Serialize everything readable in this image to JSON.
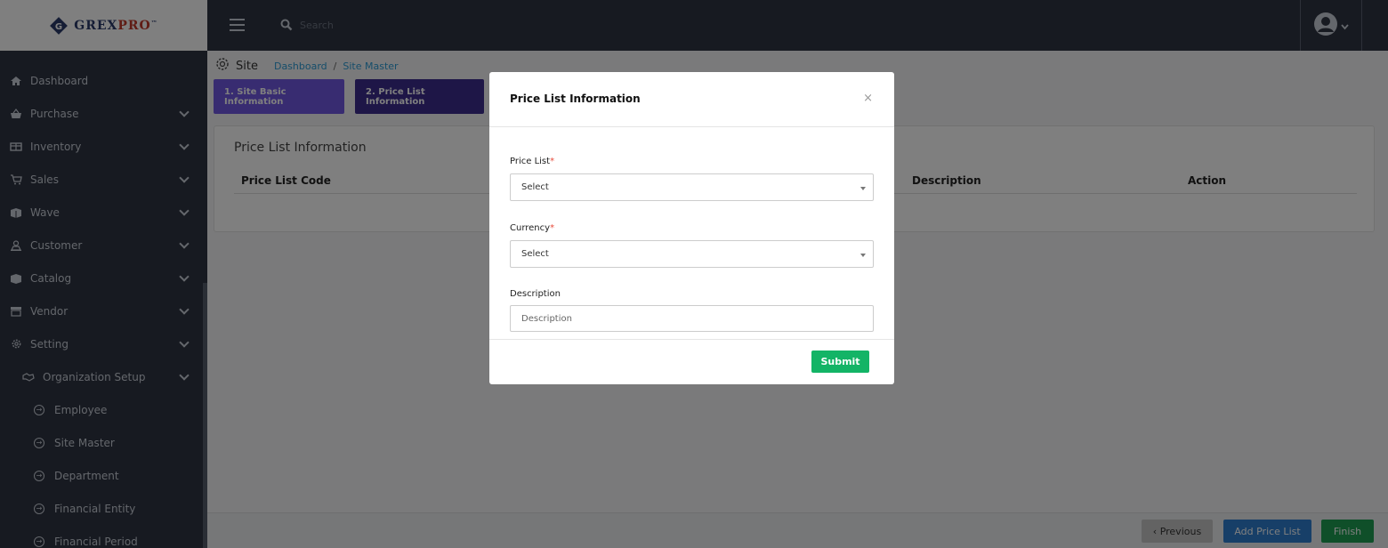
{
  "brand": {
    "logo_text_a": "GREX",
    "logo_text_b": "PRO",
    "trademark": "™"
  },
  "topbar": {
    "search_placeholder": "Search"
  },
  "sidebar": {
    "items": [
      {
        "label": "Dashboard",
        "icon": "home-icon"
      },
      {
        "label": "Purchase",
        "icon": "basket-icon"
      },
      {
        "label": "Inventory",
        "icon": "boxes-icon"
      },
      {
        "label": "Sales",
        "icon": "cart-icon"
      },
      {
        "label": "Wave",
        "icon": "package-icon"
      },
      {
        "label": "Customer",
        "icon": "users-icon"
      },
      {
        "label": "Catalog",
        "icon": "catalog-icon"
      },
      {
        "label": "Vendor",
        "icon": "store-icon"
      },
      {
        "label": "Setting",
        "icon": "gear-icon"
      }
    ],
    "org_setup": {
      "label": "Organization Setup",
      "icon": "handshake-icon"
    },
    "sub_items": [
      "Employee",
      "Site Master",
      "Department",
      "Financial Entity",
      "Financial Period"
    ]
  },
  "page": {
    "title": "Site",
    "breadcrumb": [
      "Dashboard",
      "Site Master"
    ],
    "breadcrumb_sep": "/",
    "steps": [
      "1. Site Basic Information",
      "2. Price List Information"
    ],
    "card_title": "Price List Information",
    "columns": [
      "Price List Code",
      "Description",
      "Action"
    ],
    "footer": {
      "prev": "‹ Previous",
      "add": "Add Price List",
      "finish": "Finish"
    }
  },
  "modal": {
    "title": "Price List Information",
    "close": "×",
    "fields": {
      "price_list": {
        "label": "Price List",
        "required": "*",
        "value": "Select"
      },
      "currency": {
        "label": "Currency",
        "required": "*",
        "value": "Select"
      },
      "description": {
        "label": "Description",
        "placeholder": "Description"
      }
    },
    "submit": "Submit"
  },
  "colors": {
    "sidebar": "#2f3542",
    "step_active": "#7158e2",
    "step_current": "#3c2c8f",
    "submit": "#13b466",
    "add": "#2f7fd0",
    "finish": "#1f9e52"
  }
}
